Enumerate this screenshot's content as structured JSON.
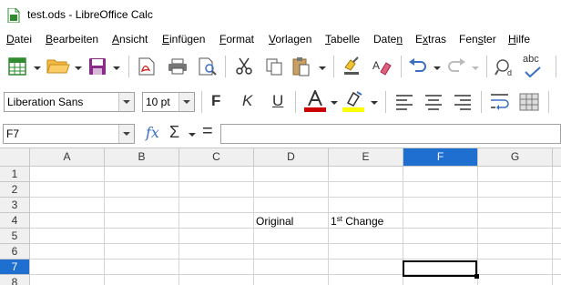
{
  "window": {
    "title": "test.ods - LibreOffice Calc"
  },
  "menu": [
    {
      "label": "Datei",
      "accel": "D"
    },
    {
      "label": "Bearbeiten",
      "accel": "B"
    },
    {
      "label": "Ansicht",
      "accel": "A"
    },
    {
      "label": "Einfügen",
      "accel": "E"
    },
    {
      "label": "Format",
      "accel": "F"
    },
    {
      "label": "Vorlagen",
      "accel": "V"
    },
    {
      "label": "Tabelle",
      "accel": "T"
    },
    {
      "label": "Daten",
      "accel": "n"
    },
    {
      "label": "Extras",
      "accel": "x"
    },
    {
      "label": "Fenster",
      "accel": "s"
    },
    {
      "label": "Hilfe",
      "accel": "H"
    }
  ],
  "toolbar": {
    "font_name": "Liberation Sans",
    "font_size": "10 pt",
    "bold_label": "F",
    "italic_label": "K",
    "underline_label": "U",
    "spellcheck_label": "abc"
  },
  "formula_bar": {
    "name_box": "F7",
    "fx_label": "fx",
    "sum_label": "Σ",
    "equals_label": "=",
    "content": ""
  },
  "sheet": {
    "columns": [
      "A",
      "B",
      "C",
      "D",
      "E",
      "F",
      "G"
    ],
    "active_column": "F",
    "rows": [
      "1",
      "2",
      "3",
      "4",
      "5",
      "6",
      "7",
      "8"
    ],
    "active_row": "7",
    "selected_cell": "F7",
    "cells": {
      "D4": "Original",
      "E4_base": "1",
      "E4_super": "st",
      "E4_rest": " Change"
    }
  },
  "colors": {
    "accent": "#1e6fd0",
    "header_bg": "#f0f0f0",
    "grid_line": "#d4d4d4",
    "font_color_bar": "#cc0000",
    "highlight_bar": "#ffff00"
  }
}
